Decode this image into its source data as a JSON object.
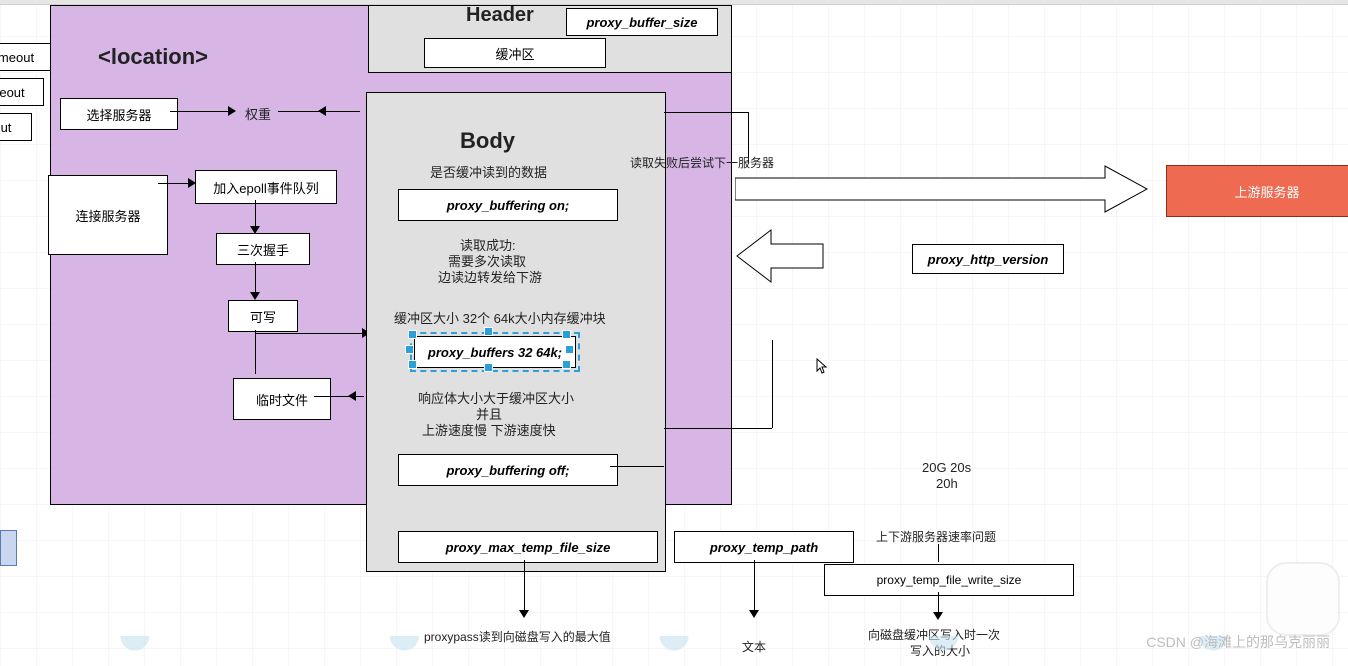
{
  "section_location": "<location>",
  "left_edges": {
    "e1": "meout",
    "e2": "eout",
    "e3": "ut"
  },
  "left": {
    "select_server": "选择服务器",
    "weight": "权重",
    "connect_server": "连接服务器",
    "epoll": "加入epoll事件队列",
    "handshake": "三次握手",
    "writable": "可写",
    "tempfile": "临时文件"
  },
  "header": {
    "title": "Header",
    "proxy_buffer_size": "proxy_buffer_size",
    "buffer": "缓冲区"
  },
  "body": {
    "title": "Body",
    "is_buffer": "是否缓冲读到的数据",
    "buffering_on": "proxy_buffering on;",
    "read_ok1": "读取成功:",
    "read_ok2": "需要多次读取",
    "read_ok3": "边读边转发给下游",
    "buf_desc": "缓冲区大小 32个 64k大小内存缓冲块",
    "buffers": "proxy_buffers 32 64k;",
    "resp1": "响应体大小大于缓冲区大小",
    "resp2": "并且",
    "resp3": "上游速度慢 下游速度快",
    "buffering_off": "proxy_buffering off;",
    "max_temp": "proxy_max_temp_file_size"
  },
  "mid": {
    "retry": "读取失败后尝试下一服务器",
    "http_ver": "proxy_http_version",
    "stats1": "20G 20s",
    "stats2": "20h"
  },
  "right": {
    "upstream": "上游服务器"
  },
  "bottom": {
    "temp_path": "proxy_temp_path",
    "rate_issue": "上下游服务器速率问题",
    "write_size": "proxy_temp_file_write_size",
    "note_left": "proxypass读到向磁盘写入的最大值",
    "note_mid": "文本",
    "note_right1": "向磁盘缓冲区写入时一次",
    "note_right2": "写入的大小"
  },
  "watermark": "CSDN @海滩上的那乌克丽丽"
}
